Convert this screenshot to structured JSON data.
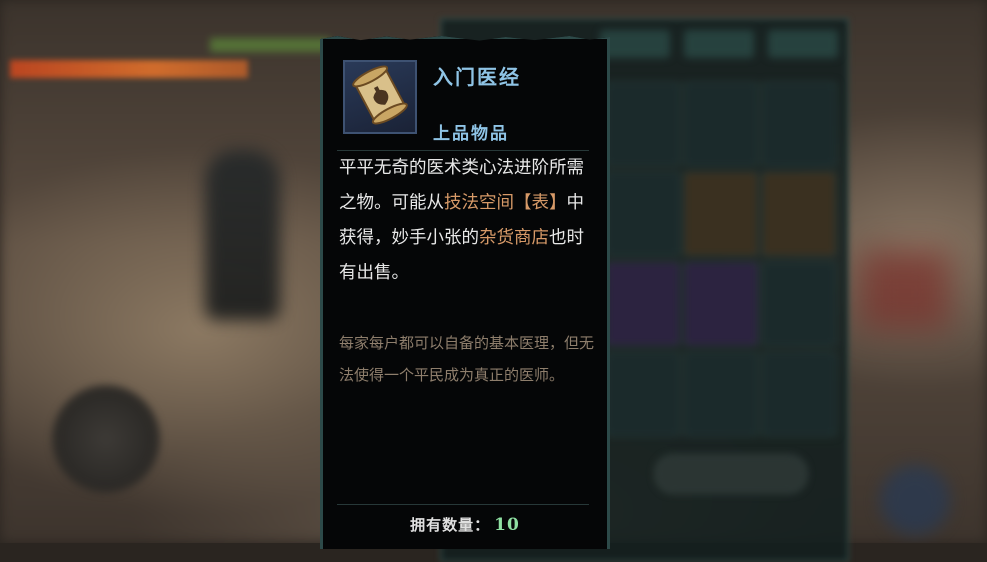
{
  "item": {
    "name": "入门医经",
    "grade": "上品物品",
    "icon": "scroll-icon",
    "description": {
      "part1": "平平无奇的医术类心法进阶所需之物。可能从",
      "link1": "技法空间【表】",
      "part2": "中获得，妙手小张的",
      "link2": "杂货商店",
      "part3": "也时有出售。"
    },
    "flavor_text": "每家每户都可以自备的基本医理，但无法使得一个平民成为真正的医师。",
    "owned_label": "拥有数量：",
    "owned_count": "10"
  },
  "colors": {
    "title": "#8fc4e6",
    "highlight": "#d79a68",
    "flavor": "#8e7e6c",
    "count": "#8fe0a2"
  }
}
